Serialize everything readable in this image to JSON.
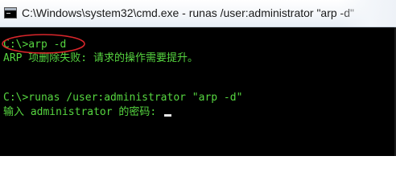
{
  "window": {
    "title": "C:\\Windows\\system32\\cmd.exe - runas  /user:administrator \"arp -d\"",
    "icon": "cmd-icon"
  },
  "console": {
    "lines": [
      "C:\\>arp -d",
      "ARP 项删除失败: 请求的操作需要提升。",
      "",
      "C:\\>runas /user:administrator \"arp -d\"",
      "输入 administrator 的密码: "
    ],
    "text_color": "#56d640",
    "background_color": "#000000"
  },
  "annotation": {
    "shape": "ellipse",
    "color": "#d9262b"
  }
}
